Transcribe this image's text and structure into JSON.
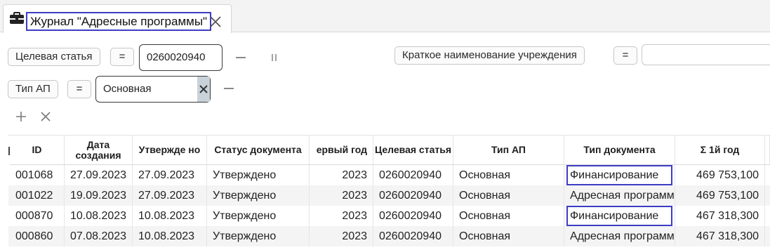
{
  "tab": {
    "icon": "briefcase-icon",
    "title": "Журнал \"Адресные программы\"",
    "close_icon": "close-icon"
  },
  "filters": {
    "target_article": {
      "label": "Целевая статья",
      "operator": "=",
      "value": "0260020940"
    },
    "institution": {
      "label": "Краткое наименование учреждения",
      "operator": "=",
      "value": ""
    },
    "ap_type": {
      "label": "Тип АП",
      "operator": "=",
      "value": "Основная"
    },
    "add_icon": "plus-icon",
    "clear_icon": "close-icon"
  },
  "grid": {
    "columns": [
      {
        "key": "id",
        "label": "ID"
      },
      {
        "key": "created",
        "label": "Дата создания"
      },
      {
        "key": "approved",
        "label": "Утвержде но"
      },
      {
        "key": "status",
        "label": "Статус документа"
      },
      {
        "key": "first_year",
        "label": "ервый год"
      },
      {
        "key": "article",
        "label": "Целевая статья"
      },
      {
        "key": "ap_type",
        "label": "Тип АП"
      },
      {
        "key": "doc_type",
        "label": "Тип документа"
      },
      {
        "key": "sum1",
        "label": "Σ 1й год"
      }
    ],
    "rows": [
      {
        "id": "001068",
        "created": "27.09.2023",
        "approved": "27.09.2023",
        "status": "Утверждено",
        "first_year": "2023",
        "article": "0260020940",
        "ap_type": "Основная",
        "doc_type": "Финансирование",
        "sum1": "469 753,100"
      },
      {
        "id": "001022",
        "created": "19.09.2023",
        "approved": "27.09.2023",
        "status": "Утверждено",
        "first_year": "2023",
        "article": "0260020940",
        "ap_type": "Основная",
        "doc_type": "Адресная программа",
        "sum1": "469 753,100"
      },
      {
        "id": "000870",
        "created": "10.08.2023",
        "approved": "10.08.2023",
        "status": "Утверждено",
        "first_year": "2023",
        "article": "0260020940",
        "ap_type": "Основная",
        "doc_type": "Финансирование",
        "sum1": "467 318,300"
      },
      {
        "id": "000860",
        "created": "07.08.2023",
        "approved": "10.08.2023",
        "status": "Утверждено",
        "first_year": "2023",
        "article": "0260020940",
        "ap_type": "Основная",
        "doc_type": "Адресная программа",
        "sum1": "467 318,300"
      }
    ]
  },
  "colors": {
    "highlight": "#3d3dc4",
    "row_alt": "#f4f4f4",
    "clear_button": "#c9d2d9"
  }
}
